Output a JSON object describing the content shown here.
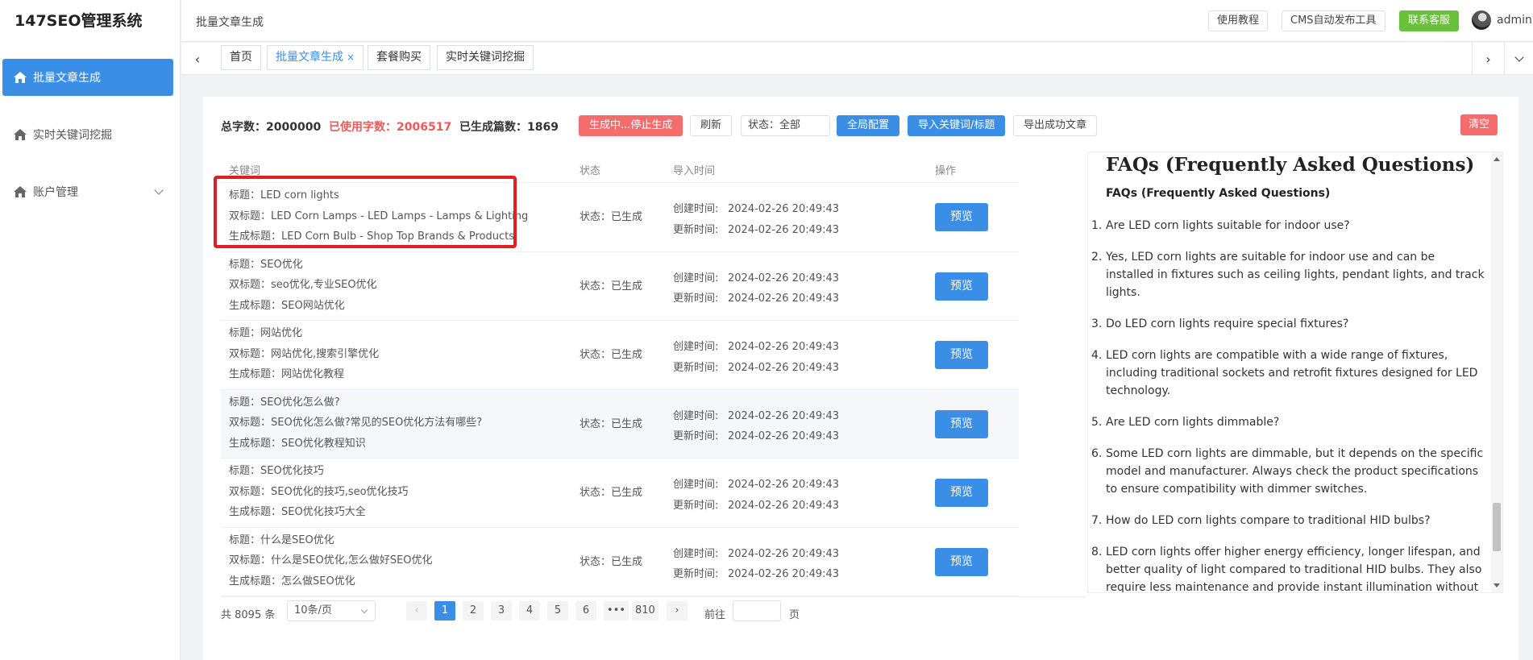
{
  "app": {
    "title": "147SEO管理系统"
  },
  "sidebar": {
    "items": [
      {
        "label": "批量文章生成",
        "icon": "home-icon",
        "active": true
      },
      {
        "label": "实时关键词挖掘",
        "icon": "home-icon",
        "active": false
      },
      {
        "label": "账户管理",
        "icon": "home-icon",
        "active": false,
        "has_submenu": true
      }
    ]
  },
  "header": {
    "breadcrumb": "批量文章生成",
    "buttons": {
      "tutorial": "使用教程",
      "cms": "CMS自动发布工具",
      "contact": "联系客服"
    },
    "user": "admin"
  },
  "tabs": [
    {
      "label": "首页",
      "active": false
    },
    {
      "label": "批量文章生成",
      "active": true,
      "closable": true
    },
    {
      "label": "套餐购买",
      "active": false
    },
    {
      "label": "实时关键词挖掘",
      "active": false
    }
  ],
  "stats": {
    "total": "总字数：2000000",
    "used": "已使用字数：2006517",
    "generated": "已生成篇数：1869"
  },
  "toolbar": {
    "stop": "生成中...停止生成",
    "refresh": "刷新",
    "status": "状态：全部",
    "config": "全局配置",
    "import": "导入关键词/标题",
    "export": "导出成功文章",
    "clear": "清空"
  },
  "table": {
    "headers": [
      "关键词",
      "状态",
      "导入时间",
      "操作"
    ],
    "created_label": "创建时间:",
    "updated_label": "更新时间:",
    "preview_label": "预览",
    "rows": [
      {
        "title": "标题：LED corn lights",
        "double": "双标题：LED Corn Lamps - LED Lamps - Lamps & Lighting",
        "gen": "生成标题：LED Corn Bulb - Shop Top Brands & Products",
        "status": "状态：已生成",
        "created": "2024-02-26 20:49:43",
        "updated": "2024-02-26 20:49:43"
      },
      {
        "title": "标题：SEO优化",
        "double": "双标题：seo优化,专业SEO优化",
        "gen": "生成标题：SEO网站优化",
        "status": "状态：已生成",
        "created": "2024-02-26 20:49:43",
        "updated": "2024-02-26 20:49:43"
      },
      {
        "title": "标题：网站优化",
        "double": "双标题：网站优化,搜索引擎优化",
        "gen": "生成标题：网站优化教程",
        "status": "状态：已生成",
        "created": "2024-02-26 20:49:43",
        "updated": "2024-02-26 20:49:43"
      },
      {
        "title": "标题：SEO优化怎么做?",
        "double": "双标题：SEO优化怎么做?常见的SEO优化方法有哪些?",
        "gen": "生成标题：SEO优化教程知识",
        "status": "状态：已生成",
        "created": "2024-02-26 20:49:43",
        "updated": "2024-02-26 20:49:43"
      },
      {
        "title": "标题：SEO优化技巧",
        "double": "双标题：SEO优化的技巧,seo优化技巧",
        "gen": "生成标题：SEO优化技巧大全",
        "status": "状态：已生成",
        "created": "2024-02-26 20:49:43",
        "updated": "2024-02-26 20:49:43"
      },
      {
        "title": "标题：什么是SEO优化",
        "double": "双标题：什么是SEO优化,怎么做好SEO优化",
        "gen": "生成标题：怎么做SEO优化",
        "status": "状态：已生成",
        "created": "2024-02-26 20:49:43",
        "updated": "2024-02-26 20:49:43"
      }
    ]
  },
  "pagination": {
    "total": "共 8095 条",
    "page_size": "10条/页",
    "pages": [
      "1",
      "2",
      "3",
      "4",
      "5",
      "6",
      "•••",
      "810"
    ],
    "current": "1",
    "goto_label": "前往",
    "page_label": "页"
  },
  "preview": {
    "h1": "FAQs (Frequently Asked Questions)",
    "h2": "FAQs (Frequently Asked Questions)",
    "items": [
      {
        "num": "1.",
        "text": "Are LED corn lights suitable for indoor use?"
      },
      {
        "num": "2.",
        "text": "Yes, LED corn lights are suitable for indoor use and can be installed in fixtures such as ceiling lights, pendant lights, and track lights."
      },
      {
        "num": "3.",
        "text": "Do LED corn lights require special fixtures?"
      },
      {
        "num": "4.",
        "text": "LED corn lights are compatible with a wide range of fixtures, including traditional sockets and retrofit fixtures designed for LED technology."
      },
      {
        "num": "5.",
        "text": "Are LED corn lights dimmable?"
      },
      {
        "num": "6.",
        "text": "Some LED corn lights are dimmable, but it depends on the specific model and manufacturer. Always check the product specifications to ensure compatibility with dimmer switches."
      },
      {
        "num": "7.",
        "text": "How do LED corn lights compare to traditional HID bulbs?"
      },
      {
        "num": "8.",
        "text": "LED corn lights offer higher energy efficiency, longer lifespan, and better quality of light compared to traditional HID bulbs. They also require less maintenance and provide instant illumination without"
      }
    ]
  },
  "colors": {
    "primary": "#3a8ee6",
    "danger": "#f56c6c",
    "success": "#67c23a",
    "highlight": "#e02020"
  }
}
